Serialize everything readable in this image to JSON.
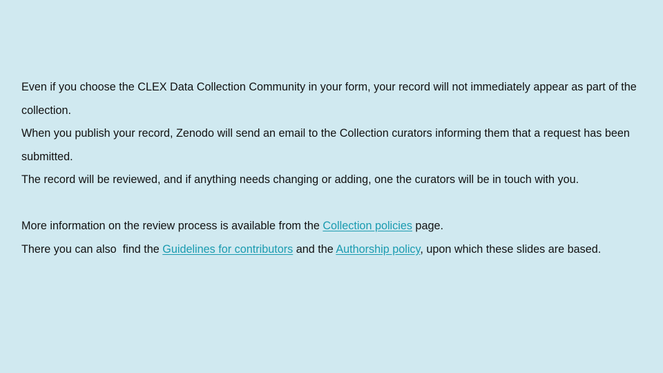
{
  "slide": {
    "paragraph_1": "Even if you choose the CLEX Data Collection Community in your form, your record will not immediately appear as part of the collection.",
    "paragraph_2": "When you publish your record, Zenodo will send an email to the Collection curators informing them that a request has been submitted.",
    "paragraph_3": "The record will be reviewed, and if anything needs changing or adding, one the curators will be in touch with you.",
    "more_info": {
      "prefix": "More information on the review process is available from the ",
      "link_collection_policies": "Collection policies",
      "suffix": " page."
    },
    "there": {
      "prefix": "There you can also  find the ",
      "link_guidelines": "Guidelines for contributors",
      "middle": " and the ",
      "link_authorship": "Authorship policy",
      "suffix": ", upon which these slides are based."
    },
    "link_color": "#1a9bb0",
    "background_color": "#d0e9f0"
  }
}
